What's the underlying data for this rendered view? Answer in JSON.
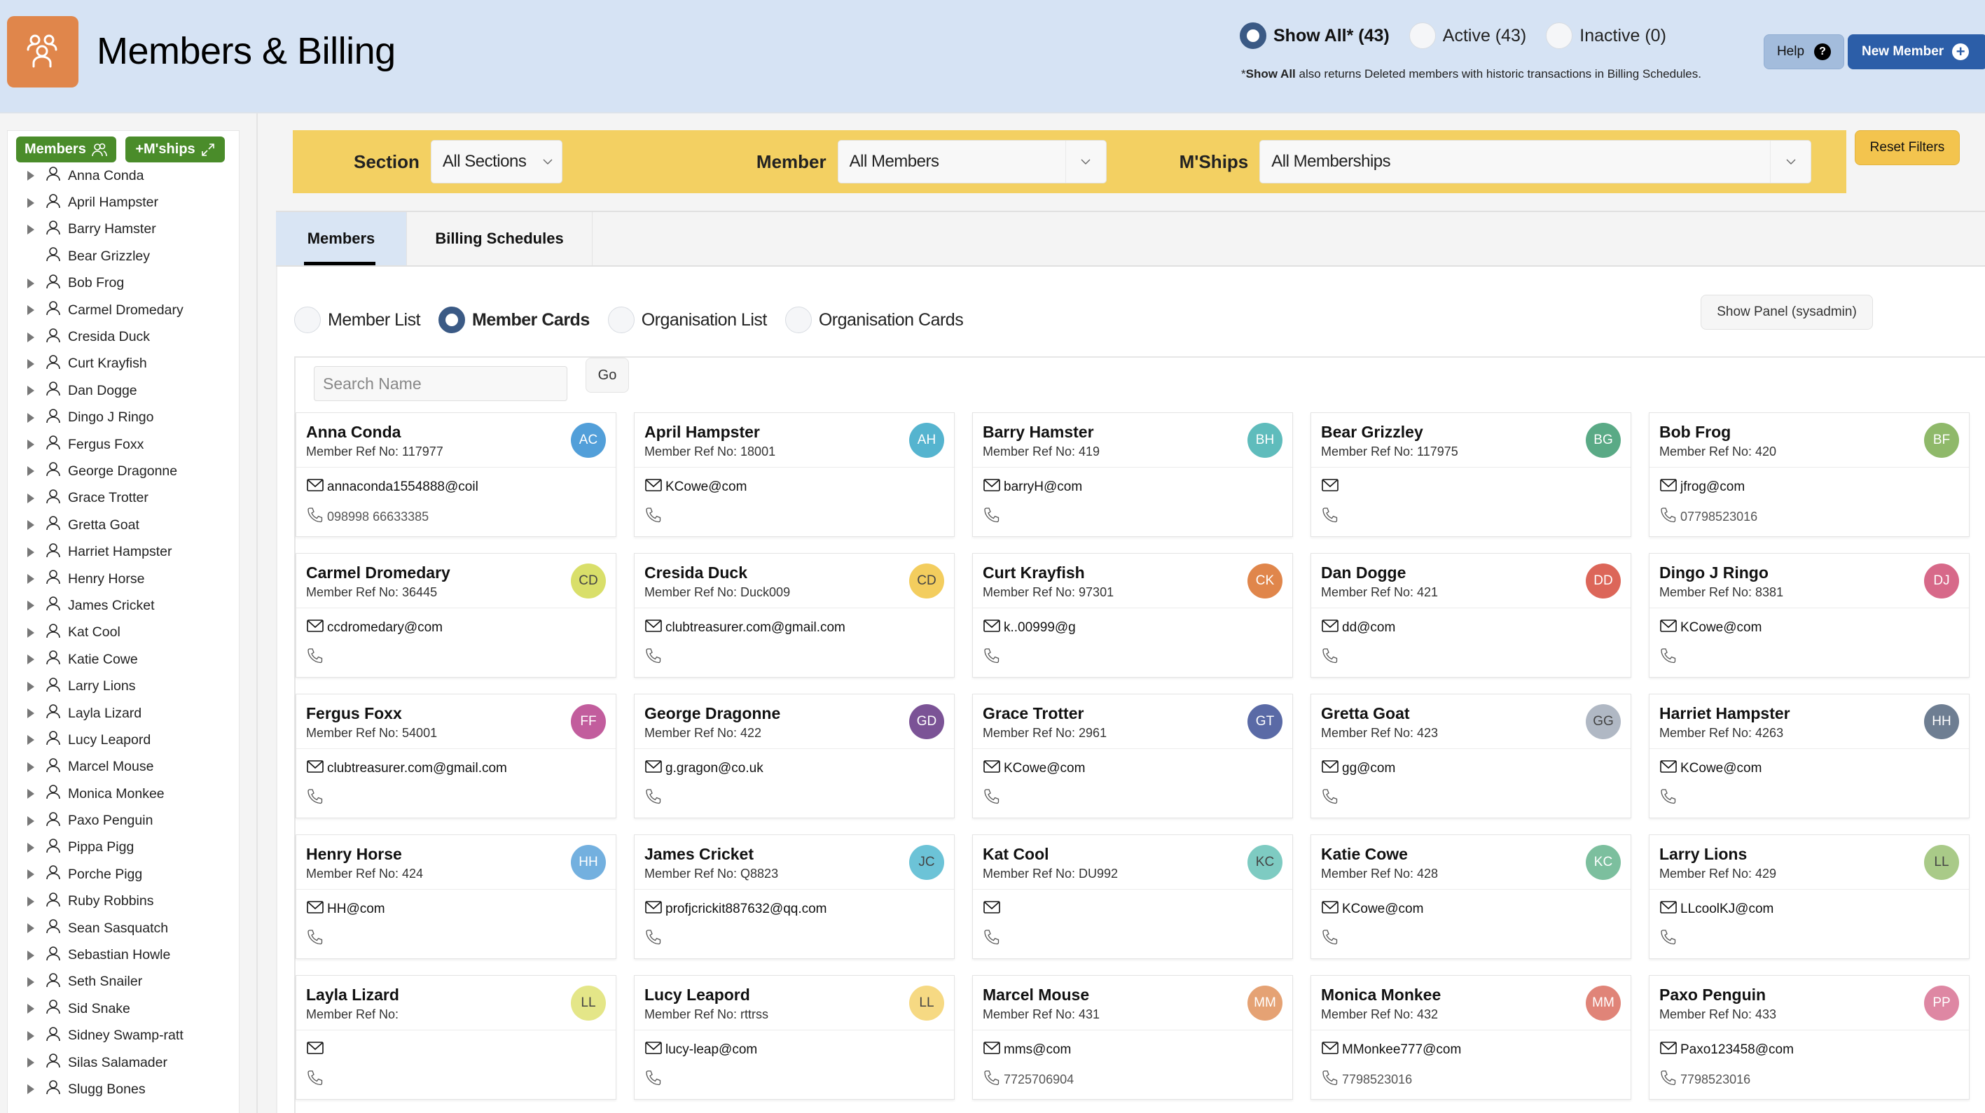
{
  "header": {
    "title": "Members & Billing",
    "status_filter": [
      {
        "label": "Show All* (43)",
        "selected": true
      },
      {
        "label": "Active (43)",
        "selected": false
      },
      {
        "label": "Inactive (0)",
        "selected": false
      }
    ],
    "note_bold": "Show All",
    "note_prefix": "*",
    "note_rest": " also returns Deleted members with historic transactions in Billing Schedules.",
    "help_label": "Help",
    "new_member_label": "New Member"
  },
  "sidebar": {
    "members_button": "Members",
    "mships_button": "+M'ships",
    "items": [
      {
        "name": "Anna Conda",
        "expandable": true
      },
      {
        "name": "April Hampster",
        "expandable": true
      },
      {
        "name": "Barry Hamster",
        "expandable": true
      },
      {
        "name": "Bear Grizzley",
        "expandable": false
      },
      {
        "name": "Bob Frog",
        "expandable": true
      },
      {
        "name": "Carmel Dromedary",
        "expandable": true
      },
      {
        "name": "Cresida Duck",
        "expandable": true
      },
      {
        "name": "Curt Krayfish",
        "expandable": true
      },
      {
        "name": "Dan Dogge",
        "expandable": true
      },
      {
        "name": "Dingo J Ringo",
        "expandable": true
      },
      {
        "name": "Fergus Foxx",
        "expandable": true
      },
      {
        "name": "George Dragonne",
        "expandable": true
      },
      {
        "name": "Grace Trotter",
        "expandable": true
      },
      {
        "name": "Gretta Goat",
        "expandable": true
      },
      {
        "name": "Harriet Hampster",
        "expandable": true
      },
      {
        "name": "Henry Horse",
        "expandable": true
      },
      {
        "name": "James Cricket",
        "expandable": true
      },
      {
        "name": "Kat Cool",
        "expandable": true
      },
      {
        "name": "Katie Cowe",
        "expandable": true
      },
      {
        "name": "Larry Lions",
        "expandable": true
      },
      {
        "name": "Layla Lizard",
        "expandable": true
      },
      {
        "name": "Lucy Leapord",
        "expandable": true
      },
      {
        "name": "Marcel Mouse",
        "expandable": true
      },
      {
        "name": "Monica Monkee",
        "expandable": true
      },
      {
        "name": "Paxo Penguin",
        "expandable": true
      },
      {
        "name": "Pippa Pigg",
        "expandable": true
      },
      {
        "name": "Porche Pigg",
        "expandable": true
      },
      {
        "name": "Ruby Robbins",
        "expandable": true
      },
      {
        "name": "Sean Sasquatch",
        "expandable": true
      },
      {
        "name": "Sebastian Howle",
        "expandable": true
      },
      {
        "name": "Seth Snailer",
        "expandable": true
      },
      {
        "name": "Sid Snake",
        "expandable": true
      },
      {
        "name": "Sidney Swamp-ratt",
        "expandable": true
      },
      {
        "name": "Silas Salamader",
        "expandable": true
      },
      {
        "name": "Slugg Bones",
        "expandable": true
      }
    ]
  },
  "filters": {
    "section_label": "Section",
    "section_value": "All Sections",
    "member_label": "Member",
    "member_value": "All Members",
    "mships_label": "M'Ships",
    "mships_value": "All Memberships",
    "reset_label": "Reset Filters"
  },
  "tabs": [
    {
      "label": "Members",
      "active": true
    },
    {
      "label": "Billing Schedules",
      "active": false
    }
  ],
  "view_options": [
    {
      "label": "Member List",
      "selected": false
    },
    {
      "label": "Member Cards",
      "selected": true
    },
    {
      "label": "Organisation List",
      "selected": false
    },
    {
      "label": "Organisation Cards",
      "selected": false
    }
  ],
  "show_panel_label": "Show Panel (sysadmin)",
  "search": {
    "placeholder": "Search Name",
    "value": "",
    "go_label": "Go"
  },
  "ref_prefix": "Member Ref No:",
  "cards": [
    {
      "name": "Anna Conda",
      "ref": "117977",
      "initials": "AC",
      "color": "#529fd9",
      "email": "annaconda1554888@coil",
      "phone": "098998 66633385"
    },
    {
      "name": "April Hampster",
      "ref": "18001",
      "initials": "AH",
      "color": "#55b4cf",
      "email": "KCowe@com",
      "phone": ""
    },
    {
      "name": "Barry Hamster",
      "ref": "419",
      "initials": "BH",
      "color": "#5fbcbc",
      "email": "barryH@com",
      "phone": ""
    },
    {
      "name": "Bear Grizzley",
      "ref": "117975",
      "initials": "BG",
      "color": "#5aaa86",
      "email": "",
      "phone": ""
    },
    {
      "name": "Bob Frog",
      "ref": "420",
      "initials": "BF",
      "color": "#8fb96a",
      "email": "jfrog@com",
      "phone": "07798523016"
    },
    {
      "name": "Carmel Dromedary",
      "ref": "36445",
      "initials": "CD",
      "color": "#d9df6a",
      "dark": true,
      "email": "ccdromedary@com",
      "phone": ""
    },
    {
      "name": "Cresida Duck",
      "ref": "Duck009",
      "initials": "CD",
      "color": "#f3cd5e",
      "dark": true,
      "email": "clubtreasurer.com@gmail.com",
      "phone": ""
    },
    {
      "name": "Curt Krayfish",
      "ref": "97301",
      "initials": "CK",
      "color": "#e0864b",
      "email": "k..00999@g",
      "phone": ""
    },
    {
      "name": "Dan Dogge",
      "ref": "421",
      "initials": "DD",
      "color": "#dc6659",
      "email": "dd@com",
      "phone": ""
    },
    {
      "name": "Dingo J Ringo",
      "ref": "8381",
      "initials": "DJ",
      "color": "#d76989",
      "email": "KCowe@com",
      "phone": ""
    },
    {
      "name": "Fergus Foxx",
      "ref": "54001",
      "initials": "FF",
      "color": "#c25d9d",
      "email": "clubtreasurer.com@gmail.com",
      "phone": ""
    },
    {
      "name": "George Dragonne",
      "ref": "422",
      "initials": "GD",
      "color": "#7b5396",
      "email": "g.gragon@co.uk",
      "phone": ""
    },
    {
      "name": "Grace Trotter",
      "ref": "2961",
      "initials": "GT",
      "color": "#5a6aa6",
      "email": "KCowe@com",
      "phone": ""
    },
    {
      "name": "Gretta Goat",
      "ref": "423",
      "initials": "GG",
      "color": "#b0b8c4",
      "dark": true,
      "email": "gg@com",
      "phone": ""
    },
    {
      "name": "Harriet Hampster",
      "ref": "4263",
      "initials": "HH",
      "color": "#6e7e92",
      "email": "KCowe@com",
      "phone": ""
    },
    {
      "name": "Henry Horse",
      "ref": "424",
      "initials": "HH",
      "color": "#73b0df",
      "email": "HH@com",
      "phone": ""
    },
    {
      "name": "James Cricket",
      "ref": "Q8823",
      "initials": "JC",
      "color": "#6cc3d7",
      "dark": true,
      "email": "profjcrickit887632@qq.com",
      "phone": ""
    },
    {
      "name": "Kat Cool",
      "ref": "DU992",
      "initials": "KC",
      "color": "#7ecbc2",
      "dark": true,
      "email": "",
      "phone": ""
    },
    {
      "name": "Katie Cowe",
      "ref": "428",
      "initials": "KC",
      "color": "#7cbf9e",
      "email": "KCowe@com",
      "phone": ""
    },
    {
      "name": "Larry Lions",
      "ref": "429",
      "initials": "LL",
      "color": "#a9ca88",
      "dark": true,
      "email": "LLcoolKJ@com",
      "phone": ""
    },
    {
      "name": "Layla Lizard",
      "ref": "",
      "initials": "LL",
      "color": "#e4e688",
      "dark": true,
      "email": "",
      "phone": ""
    },
    {
      "name": "Lucy Leapord",
      "ref": "rttrss",
      "initials": "LL",
      "color": "#f6d983",
      "dark": true,
      "email": "lucy-leap@com",
      "phone": ""
    },
    {
      "name": "Marcel Mouse",
      "ref": "431",
      "initials": "MM",
      "color": "#e5a274",
      "email": "mms@com",
      "phone": "7725706904"
    },
    {
      "name": "Monica Monkee",
      "ref": "432",
      "initials": "MM",
      "color": "#e08478",
      "email": "MMonkee777@com",
      "phone": "7798523016"
    },
    {
      "name": "Paxo Penguin",
      "ref": "433",
      "initials": "PP",
      "color": "#de87a3",
      "email": "Paxo123458@com",
      "phone": "7798523016"
    }
  ]
}
